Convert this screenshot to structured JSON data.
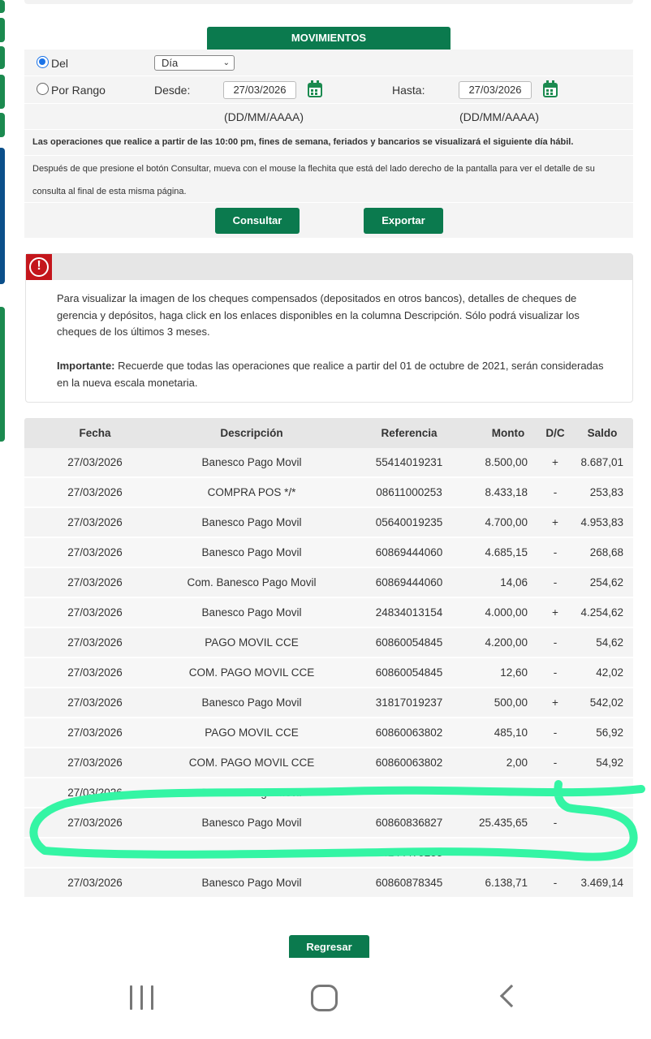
{
  "colors": {
    "brand_green": "#0b7a4e",
    "side_blue": "#0b4f8a",
    "alert_red": "#c4161c",
    "highlighter": "#34f5a4"
  },
  "header": {
    "title": "MOVIMIENTOS"
  },
  "form": {
    "del_label": "Del",
    "period_value": "Día",
    "rango_label": "Por Rango",
    "desde_label": "Desde:",
    "desde_value": "27/03/2026",
    "hasta_label": "Hasta:",
    "hasta_value": "27/03/2026",
    "date_format": "(DD/MM/AAAA)",
    "notice": "Las operaciones que realice a partir de las 10:00 pm, fines de semana, feriados y bancarios se visualizará el siguiente día hábil.",
    "instructions_1": "Después de que presione el botón Consultar, mueva con el mouse la flechita que está del lado derecho de la pantalla para ver el detalle de su",
    "instructions_2": "consulta al final de esta misma página.",
    "consultar_label": "Consultar",
    "exportar_label": "Exportar"
  },
  "info": {
    "icon": "alert-icon",
    "alert_glyph": "!",
    "paragraph_1": "Para visualizar la imagen de los cheques compensados (depositados en otros bancos), detalles de cheques de gerencia y depósitos, haga click en los enlaces disponibles en la columna Descripción. Sólo podrá visualizar los cheques de los últimos 3 meses.",
    "importante_label": "Importante:",
    "paragraph_2": " Recuerde que todas las operaciones que realice a partir del 01 de octubre de 2021, serán consideradas en la nueva escala monetaria."
  },
  "table": {
    "headers": [
      "Fecha",
      "Descripción",
      "Referencia",
      "Monto",
      "D/C",
      "Saldo"
    ],
    "rows": [
      [
        "27/03/2026",
        "Banesco Pago Movil",
        "55414019231",
        "8.500,00",
        "+",
        "8.687,01"
      ],
      [
        "27/03/2026",
        "COMPRA POS */*",
        "08611000253",
        "8.433,18",
        "-",
        "253,83"
      ],
      [
        "27/03/2026",
        "Banesco Pago Movil",
        "05640019235",
        "4.700,00",
        "+",
        "4.953,83"
      ],
      [
        "27/03/2026",
        "Banesco Pago Movil",
        "60869444060",
        "4.685,15",
        "-",
        "268,68"
      ],
      [
        "27/03/2026",
        "Com. Banesco Pago Movil",
        "60869444060",
        "14,06",
        "-",
        "254,62"
      ],
      [
        "27/03/2026",
        "Banesco Pago Movil",
        "24834013154",
        "4.000,00",
        "+",
        "4.254,62"
      ],
      [
        "27/03/2026",
        "PAGO MOVIL CCE",
        "60860054845",
        "4.200,00",
        "-",
        "54,62"
      ],
      [
        "27/03/2026",
        "COM. PAGO MOVIL CCE",
        "60860054845",
        "12,60",
        "-",
        "42,02"
      ],
      [
        "27/03/2026",
        "Banesco Pago Movil",
        "31817019237",
        "500,00",
        "+",
        "542,02"
      ],
      [
        "27/03/2026",
        "PAGO MOVIL CCE",
        "60860063802",
        "485,10",
        "-",
        "56,92"
      ],
      [
        "27/03/2026",
        "COM. PAGO MOVIL CCE",
        "60860063802",
        "2,00",
        "-",
        "54,92"
      ],
      [
        "27/03/2026",
        "Banesco Pago Movil",
        "",
        "",
        "",
        ""
      ],
      [
        "27/03/2026",
        "Banesco Pago Movil",
        "60860836827",
        "25.435,65",
        "-",
        ""
      ],
      [
        "",
        "",
        "04144475233",
        "",
        "-",
        ""
      ],
      [
        "27/03/2026",
        "Banesco Pago Movil",
        "60860878345",
        "6.138,71",
        "-",
        "3.469,14"
      ]
    ]
  },
  "footer": {
    "regresar_label": "Regresar"
  },
  "navbar": {
    "recent_icon": "recent-apps-icon",
    "home_icon": "home-icon",
    "back_icon": "back-icon"
  }
}
